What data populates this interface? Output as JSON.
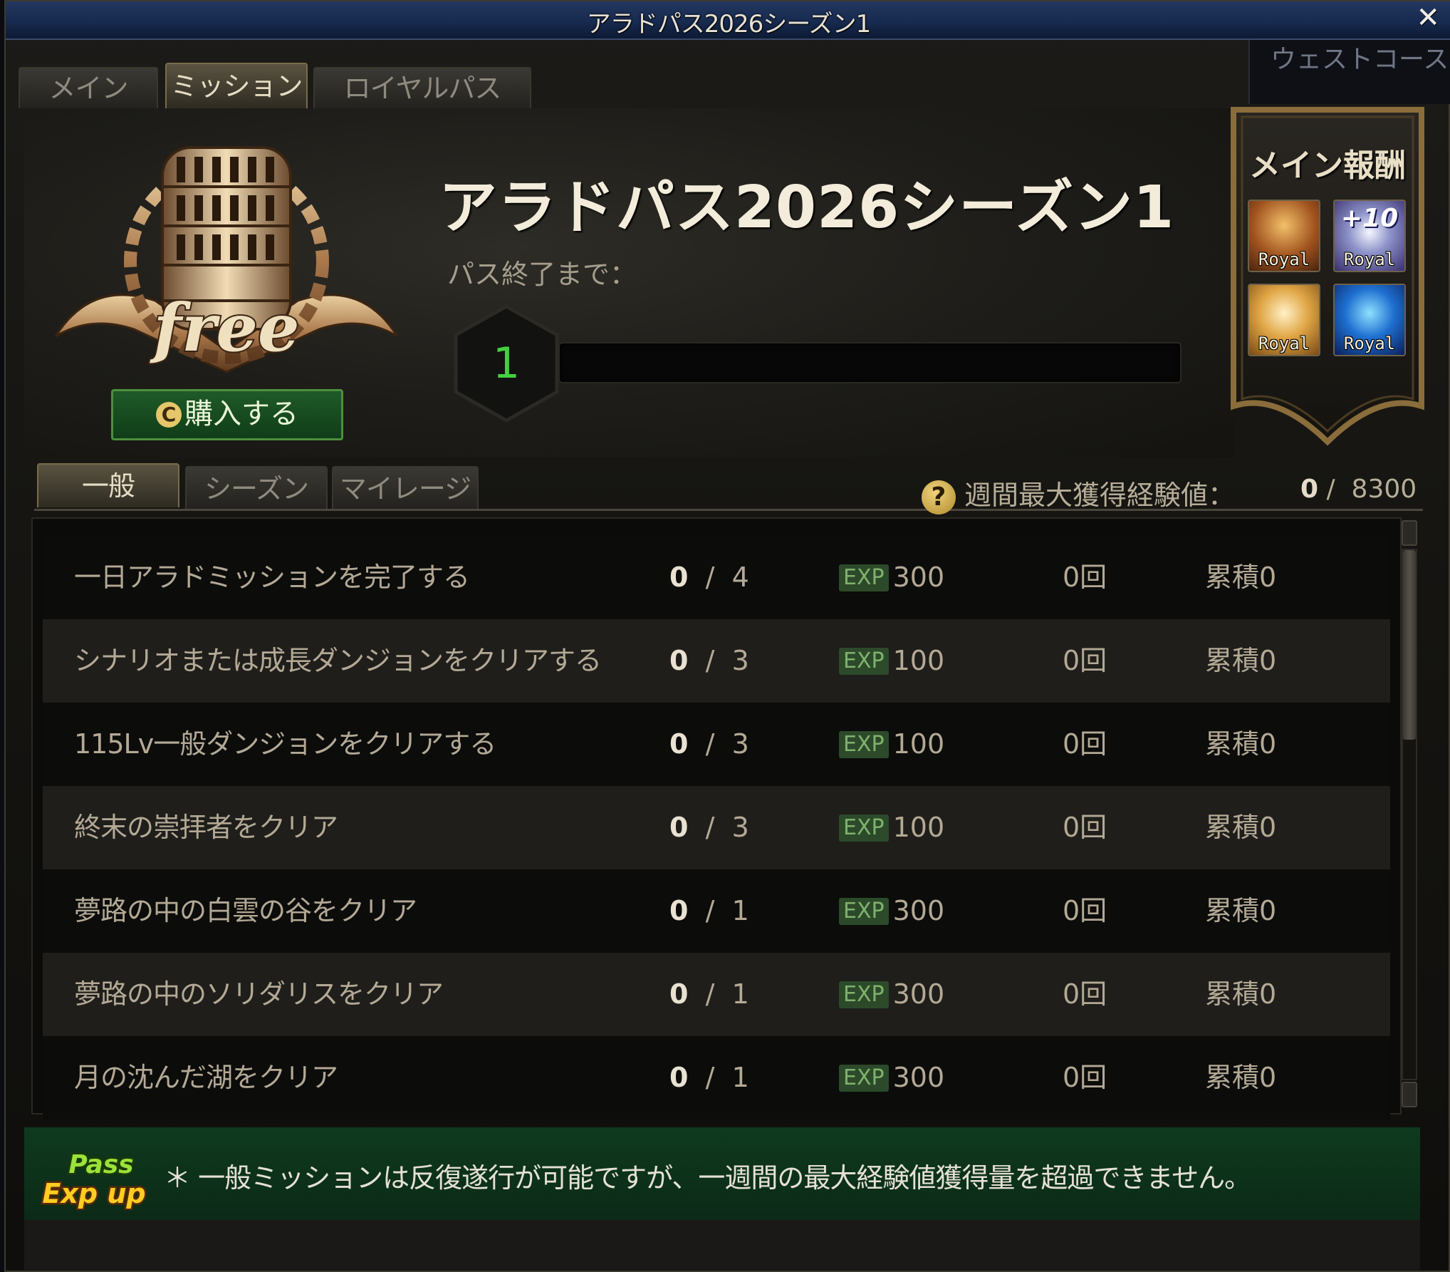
{
  "window": {
    "title": "アラドパス2026シーズン1",
    "close_label": "✕"
  },
  "background_text": "ウェストコースト",
  "main_tabs": [
    {
      "label": "メイン",
      "active": false
    },
    {
      "label": "ミッション",
      "active": true
    },
    {
      "label": "ロイヤルパス",
      "active": false
    }
  ],
  "header": {
    "pass_title": "アラドパス2026シーズン1",
    "until_end_label": "パス終了まで：",
    "level": "1",
    "progress_fraction": 0,
    "buy_button_icon": "C",
    "buy_button_label": "購入する",
    "emblem_text": "free"
  },
  "main_reward": {
    "title": "メイン報酬",
    "items": [
      {
        "icon": "trophy-icon",
        "label": "Royal",
        "overlay": ""
      },
      {
        "icon": "reinforce-ticket-icon",
        "label": "Royal",
        "overlay": "+10"
      },
      {
        "icon": "gold-box-icon",
        "label": "Royal",
        "overlay": ""
      },
      {
        "icon": "costume-icon",
        "label": "Royal",
        "overlay": ""
      }
    ]
  },
  "sub_tabs": [
    {
      "label": "一般",
      "active": true
    },
    {
      "label": "シーズン",
      "active": false
    },
    {
      "label": "マイレージ",
      "active": false
    }
  ],
  "weekly": {
    "help_icon": "?",
    "label": "週間最大獲得経験値：",
    "current": "0",
    "separator": "/",
    "max": "8300"
  },
  "missions": [
    {
      "name": "一日アラドミッションを完了する",
      "done": "0",
      "sep": "/",
      "goal": "4",
      "exp_tag": "EXP",
      "exp": "300",
      "count": "0回",
      "accum": "累積0"
    },
    {
      "name": "シナリオまたは成長ダンジョンをクリアする",
      "done": "0",
      "sep": "/",
      "goal": "3",
      "exp_tag": "EXP",
      "exp": "100",
      "count": "0回",
      "accum": "累積0"
    },
    {
      "name": "115Lv一般ダンジョンをクリアする",
      "done": "0",
      "sep": "/",
      "goal": "3",
      "exp_tag": "EXP",
      "exp": "100",
      "count": "0回",
      "accum": "累積0"
    },
    {
      "name": "終末の崇拝者をクリア",
      "done": "0",
      "sep": "/",
      "goal": "3",
      "exp_tag": "EXP",
      "exp": "100",
      "count": "0回",
      "accum": "累積0"
    },
    {
      "name": "夢路の中の白雲の谷をクリア",
      "done": "0",
      "sep": "/",
      "goal": "1",
      "exp_tag": "EXP",
      "exp": "300",
      "count": "0回",
      "accum": "累積0"
    },
    {
      "name": "夢路の中のソリダリスをクリア",
      "done": "0",
      "sep": "/",
      "goal": "1",
      "exp_tag": "EXP",
      "exp": "300",
      "count": "0回",
      "accum": "累積0"
    },
    {
      "name": "月の沈んだ湖をクリア",
      "done": "0",
      "sep": "/",
      "goal": "1",
      "exp_tag": "EXP",
      "exp": "300",
      "count": "0回",
      "accum": "累積0"
    }
  ],
  "footer": {
    "badge_line1": "Pass",
    "badge_line2": "Exp up",
    "note": "＊ 一般ミッションは反復遂行が可能ですが、一週間の最大経験値獲得量を超過できません。"
  },
  "colors": {
    "accent_green": "#43d13f",
    "gold": "#e5c66a",
    "title_blue": "#172a4f"
  }
}
